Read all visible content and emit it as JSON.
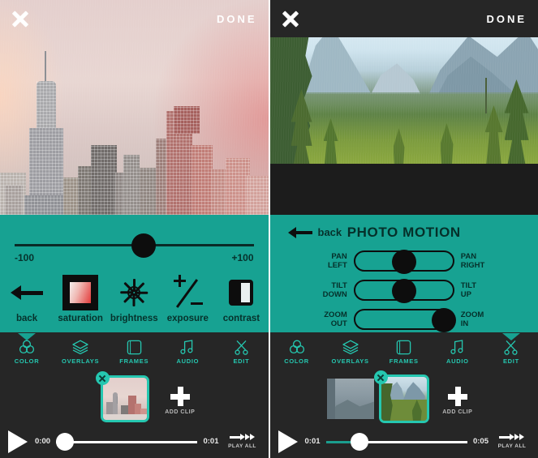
{
  "theme": {
    "teal": "#17A292",
    "teal_bright": "#25C7B0",
    "dark": "#262626",
    "black": "#0d0d0d",
    "white": "#ffffff",
    "fill_green": "#1B9E8F"
  },
  "left_panel": {
    "topbar": {
      "close_icon": "close-icon",
      "done_label": "DONE"
    },
    "photo": {
      "name": "nyc-skyline-photo",
      "alt_glyph": "city-skyline"
    },
    "slider": {
      "min_label": "-100",
      "max_label": "+100",
      "value_percent": 54
    },
    "tools": [
      {
        "label": "back",
        "icon": "arrow-left-icon",
        "selected": false
      },
      {
        "label": "saturation",
        "icon": "saturation-icon",
        "selected": true
      },
      {
        "label": "brightness",
        "icon": "brightness-icon",
        "selected": false
      },
      {
        "label": "exposure",
        "icon": "exposure-icon",
        "selected": false
      },
      {
        "label": "contrast",
        "icon": "contrast-icon",
        "selected": false
      }
    ],
    "nav": {
      "active_index": 0,
      "items": [
        {
          "label": "COLOR",
          "icon": "color-circles-icon"
        },
        {
          "label": "OVERLAYS",
          "icon": "layers-icon"
        },
        {
          "label": "FRAMES",
          "icon": "frame-square-icon"
        },
        {
          "label": "AUDIO",
          "icon": "music-note-icon"
        },
        {
          "label": "EDIT",
          "icon": "scissors-icon"
        }
      ]
    },
    "clips": {
      "items": [
        {
          "name": "clip-nyc",
          "selected": true,
          "has_delete_badge": true
        }
      ],
      "add_clip_label": "ADD CLIP",
      "add_clip_icon": "plus-icon"
    },
    "playback": {
      "play_icon": "play-icon",
      "current_time": "0:00",
      "total_time": "0:01",
      "progress_percent": 0,
      "play_all_label": "PLAY ALL",
      "play_all_icon": "fast-forward-icon"
    }
  },
  "right_panel": {
    "topbar": {
      "close_icon": "close-icon",
      "done_label": "DONE"
    },
    "photo": {
      "name": "yosemite-valley-photo",
      "alt_glyph": "mountain-valley"
    },
    "motion": {
      "back_label": "back",
      "back_icon": "arrow-left-icon",
      "title": "PHOTO MOTION",
      "rows": [
        {
          "left_label": "PAN\nLEFT",
          "right_label": "PAN\nRIGHT",
          "position_percent": 50,
          "name": "pan-toggle"
        },
        {
          "left_label": "TILT\nDOWN",
          "right_label": "TILT\nUP",
          "position_percent": 50,
          "name": "tilt-toggle"
        },
        {
          "left_label": "ZOOM\nOUT",
          "right_label": "ZOOM\nIN",
          "position_percent": 100,
          "name": "zoom-toggle"
        }
      ]
    },
    "nav": {
      "active_index": 4,
      "items": [
        {
          "label": "COLOR",
          "icon": "color-circles-icon"
        },
        {
          "label": "OVERLAYS",
          "icon": "layers-icon"
        },
        {
          "label": "FRAMES",
          "icon": "frame-square-icon"
        },
        {
          "label": "AUDIO",
          "icon": "music-note-icon"
        },
        {
          "label": "EDIT",
          "icon": "scissors-icon"
        }
      ]
    },
    "clips": {
      "items": [
        {
          "name": "clip-yosemite-dim",
          "selected": false,
          "has_delete_badge": false
        },
        {
          "name": "clip-yosemite",
          "selected": true,
          "has_delete_badge": true
        }
      ],
      "add_clip_label": "ADD CLIP",
      "add_clip_icon": "plus-icon"
    },
    "playback": {
      "play_icon": "play-icon",
      "current_time": "0:01",
      "total_time": "0:05",
      "progress_percent": 24,
      "play_all_label": "PLAY ALL",
      "play_all_icon": "fast-forward-icon"
    }
  }
}
